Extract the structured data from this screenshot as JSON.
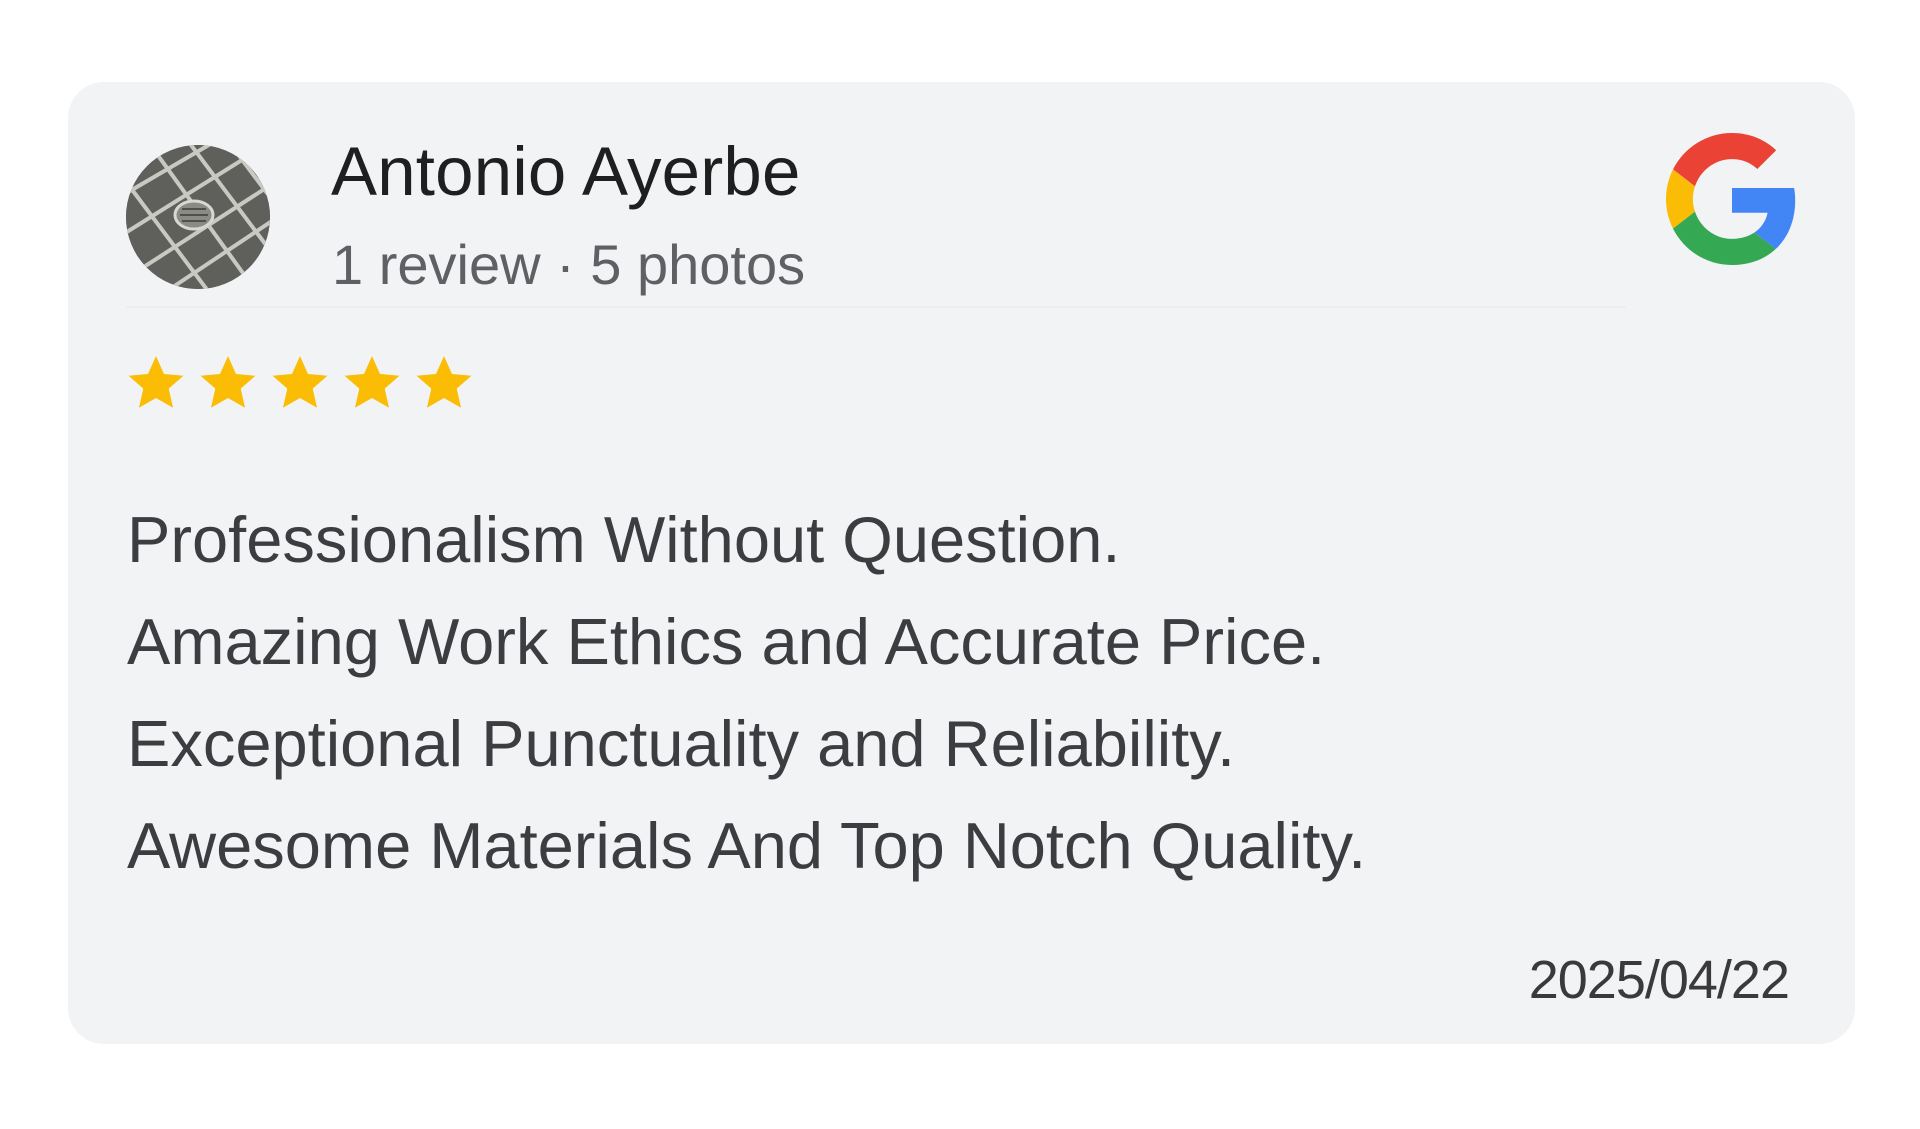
{
  "review": {
    "author_name": "Antonio Ayerbe",
    "author_meta": "1 review · 5 photos",
    "rating": 5,
    "rating_max": 5,
    "lines": [
      "Professionalism Without Question.",
      "Amazing Work Ethics and Accurate Price.",
      "Exceptional Punctuality and Reliability.",
      "Awesome Materials And Top Notch Quality."
    ],
    "date": "2025/04/22"
  },
  "icons": {
    "avatar": "avatar-photo-floor-drain",
    "source": "google-g-icon",
    "star": "star-icon"
  },
  "colors": {
    "card_background": "#f2f3f5",
    "star": "#fbbc04",
    "google_red": "#ea4335",
    "google_yellow": "#fbbc05",
    "google_green": "#34a853",
    "google_blue": "#4285f4"
  }
}
